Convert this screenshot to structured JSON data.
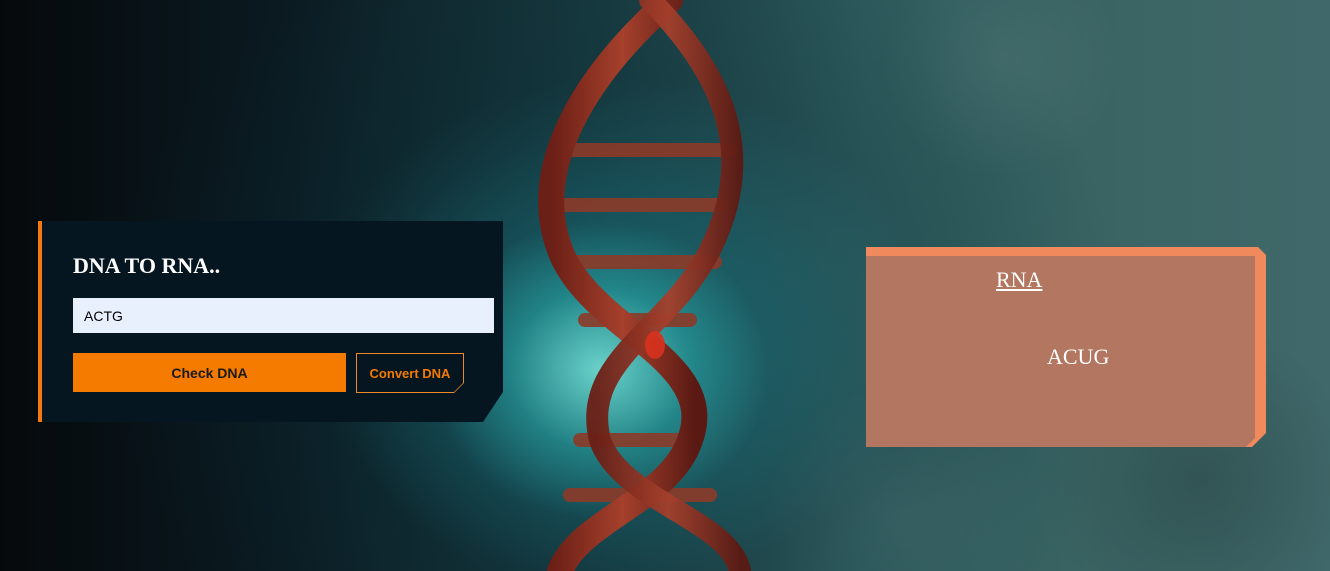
{
  "converter": {
    "title": "DNA TO RNA..",
    "input": {
      "value": "ACTG",
      "placeholder": ""
    },
    "check_button": "Check DNA",
    "convert_button": "Convert DNA"
  },
  "result": {
    "title": "RNA",
    "value": "ACUG"
  },
  "colors": {
    "accent": "#f47a00",
    "card_bg": "#061620",
    "result_card_bg": "#b37660",
    "result_card_border": "#f08a5c"
  },
  "background": {
    "image": "dna-helix-illustration"
  }
}
